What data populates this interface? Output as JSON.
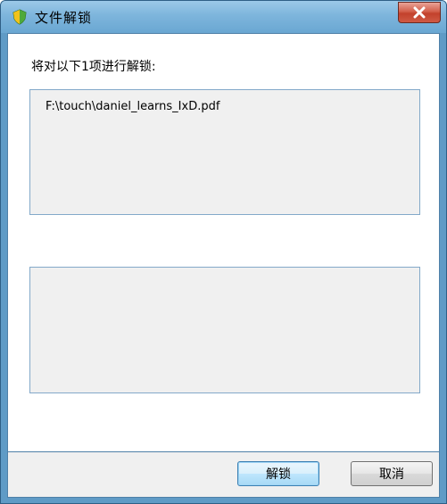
{
  "window": {
    "title": "文件解锁",
    "title_icon": "shield-icon",
    "close_icon": "close-icon"
  },
  "content": {
    "prompt": "将对以下1项进行解锁:",
    "files": [
      "F:\\touch\\daniel_learns_IxD.pdf"
    ]
  },
  "buttons": {
    "unlock_label": "解锁",
    "cancel_label": "取消"
  },
  "colors": {
    "titlebar": "#7db5dc",
    "close_button": "#c8452f",
    "listbox_border": "#83a9c9",
    "listbox_bg": "#f0f0f0"
  }
}
